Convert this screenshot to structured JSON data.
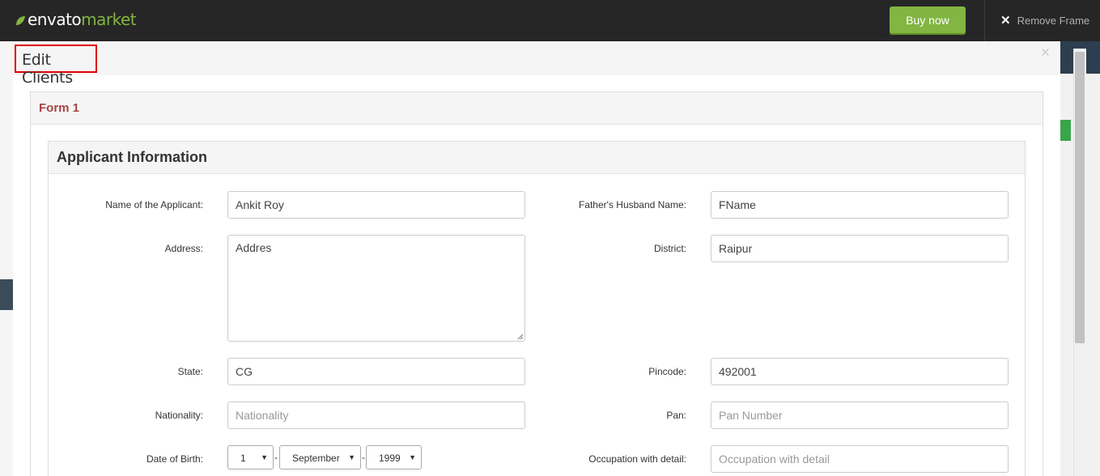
{
  "topbar": {
    "logo_part1": "envato",
    "logo_part2": "market",
    "buy_label": "Buy now",
    "remove_frame_label": "Remove Frame",
    "brand_color": "#82b541",
    "icons": [
      "leaf-icon",
      "close-icon"
    ]
  },
  "modal": {
    "title": "Edit Clients",
    "close_glyph": "×"
  },
  "form": {
    "panel_title": "Form 1",
    "section_title": "Applicant Information",
    "fields": {
      "name": {
        "label": "Name of the Applicant:",
        "value": "Ankit Roy",
        "placeholder": ""
      },
      "father": {
        "label": "Father's Husband Name:",
        "value": "FName",
        "placeholder": ""
      },
      "address": {
        "label": "Address:",
        "value": "Addres",
        "placeholder": ""
      },
      "district": {
        "label": "District:",
        "value": "Raipur",
        "placeholder": ""
      },
      "state": {
        "label": "State:",
        "value": "CG",
        "placeholder": ""
      },
      "pincode": {
        "label": "Pincode:",
        "value": "492001",
        "placeholder": ""
      },
      "nationality": {
        "label": "Nationality:",
        "value": "",
        "placeholder": "Nationality"
      },
      "pan": {
        "label": "Pan:",
        "value": "",
        "placeholder": "Pan Number"
      },
      "dob": {
        "label": "Date of Birth:",
        "day": "1",
        "month": "September",
        "year": "1999",
        "separator": "-"
      },
      "occupation": {
        "label": "Occupation with detail:",
        "value": "",
        "placeholder": "Occupation with detail"
      }
    }
  },
  "colors": {
    "topbar_bg": "#262626",
    "form_title": "#a94442",
    "highlight_border": "#e00000"
  }
}
